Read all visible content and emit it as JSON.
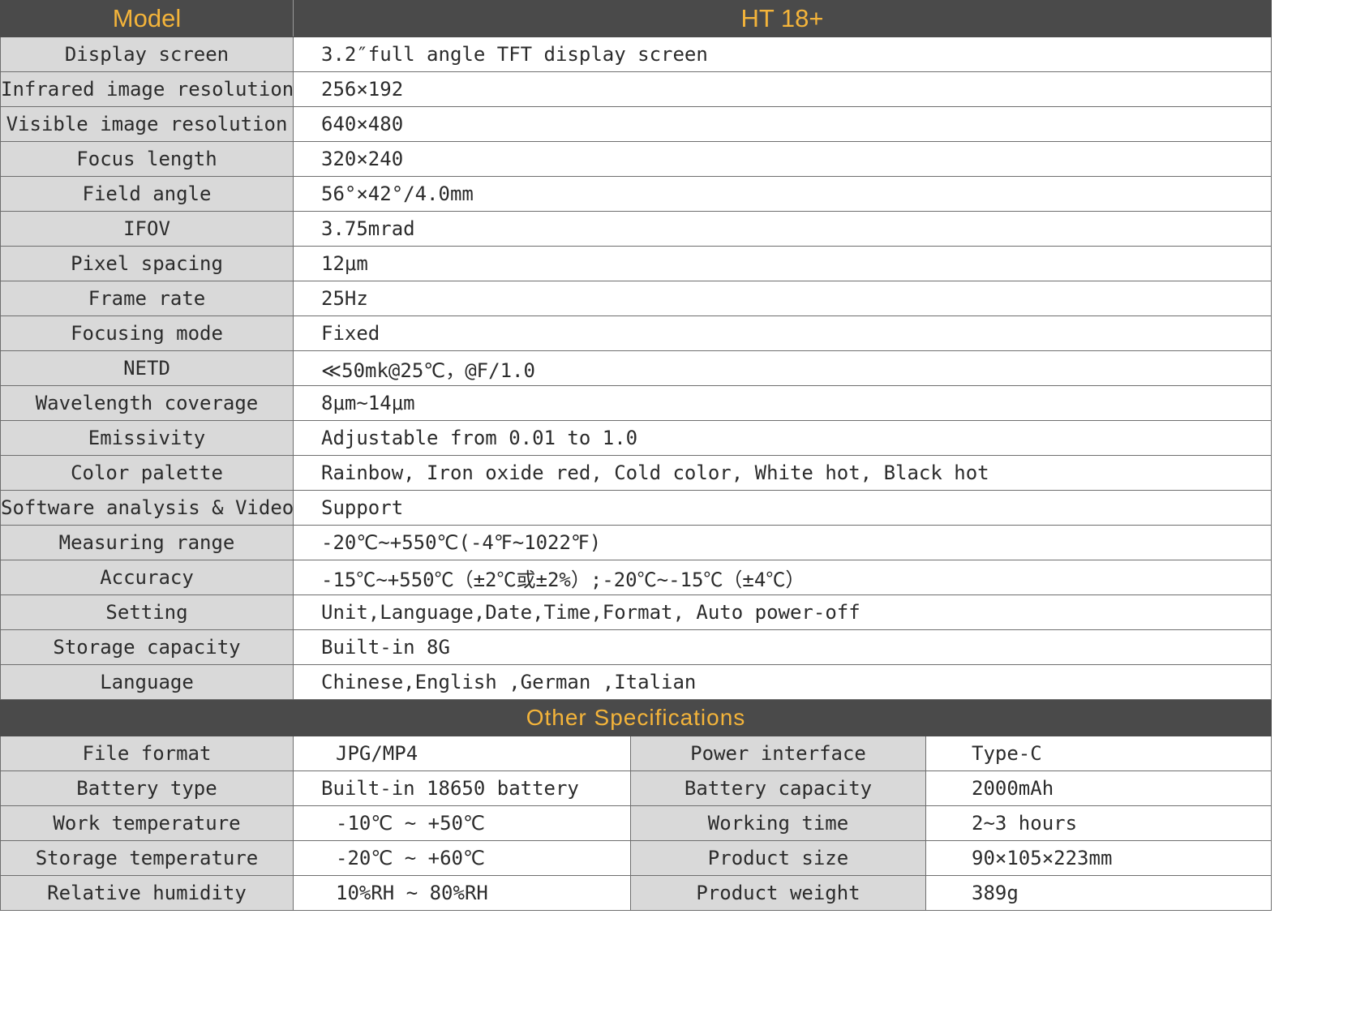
{
  "header": {
    "model_label": "Model",
    "model_value": "HT 18+"
  },
  "specs": [
    {
      "label": "Display screen",
      "value": "3.2″full angle TFT  display screen"
    },
    {
      "label": "Infrared image resolution",
      "value": "256×192"
    },
    {
      "label": "Visible image resolution",
      "value": "640×480"
    },
    {
      "label": "Focus length",
      "value": "320×240"
    },
    {
      "label": "Field angle",
      "value": "56°×42°/4.0mm"
    },
    {
      "label": "IFOV",
      "value": "3.75mrad"
    },
    {
      "label": "Pixel  spacing",
      "value": "12μm"
    },
    {
      "label": "Frame rate",
      "value": "25Hz"
    },
    {
      "label": "Focusing mode",
      "value": "Fixed"
    },
    {
      "label": "NETD",
      "value": "≪50mk@25℃，@F/1.0"
    },
    {
      "label": "Wavelength coverage",
      "value": "8μm~14μm"
    },
    {
      "label": "Emissivity",
      "value": "Adjustable from 0.01 to 1.0"
    },
    {
      "label": "Color palette",
      "value": "Rainbow, Iron oxide red, Cold color, White hot, Black hot"
    },
    {
      "label": "Software analysis & Video",
      "value": "Support"
    },
    {
      "label": "Measuring range",
      "value": "-20℃~+550℃(-4℉~1022℉)"
    },
    {
      "label": "Accuracy",
      "value": "-15℃~+550℃（±2℃或±2%）;-20℃~-15℃（±4℃）"
    },
    {
      "label": "Setting",
      "value": "Unit,Language,Date,Time,Format, Auto power-off"
    },
    {
      "label": "Storage capacity",
      "value": "Built-in 8G"
    },
    {
      "label": "Language",
      "value": "Chinese,English ,German ,Italian"
    }
  ],
  "other": {
    "title": "Other Specifications",
    "rows": [
      {
        "label1": "File format",
        "value1": "JPG/MP4",
        "label2": "Power interface",
        "value2": "Type-C"
      },
      {
        "label1": "Battery type",
        "value1": "Built-in 18650 battery",
        "label2": "Battery capacity",
        "value2": "2000mAh"
      },
      {
        "label1": "Work temperature",
        "value1": "-10℃ ~ +50℃",
        "label2": "Working time",
        "value2": "2~3 hours"
      },
      {
        "label1": "Storage temperature",
        "value1": "-20℃ ~ +60℃",
        "label2": "Product size",
        "value2": "90×105×223mm"
      },
      {
        "label1": "Relative humidity",
        "value1": "10%RH ~ 80%RH",
        "label2": "Product weight",
        "value2": "389g"
      }
    ]
  }
}
